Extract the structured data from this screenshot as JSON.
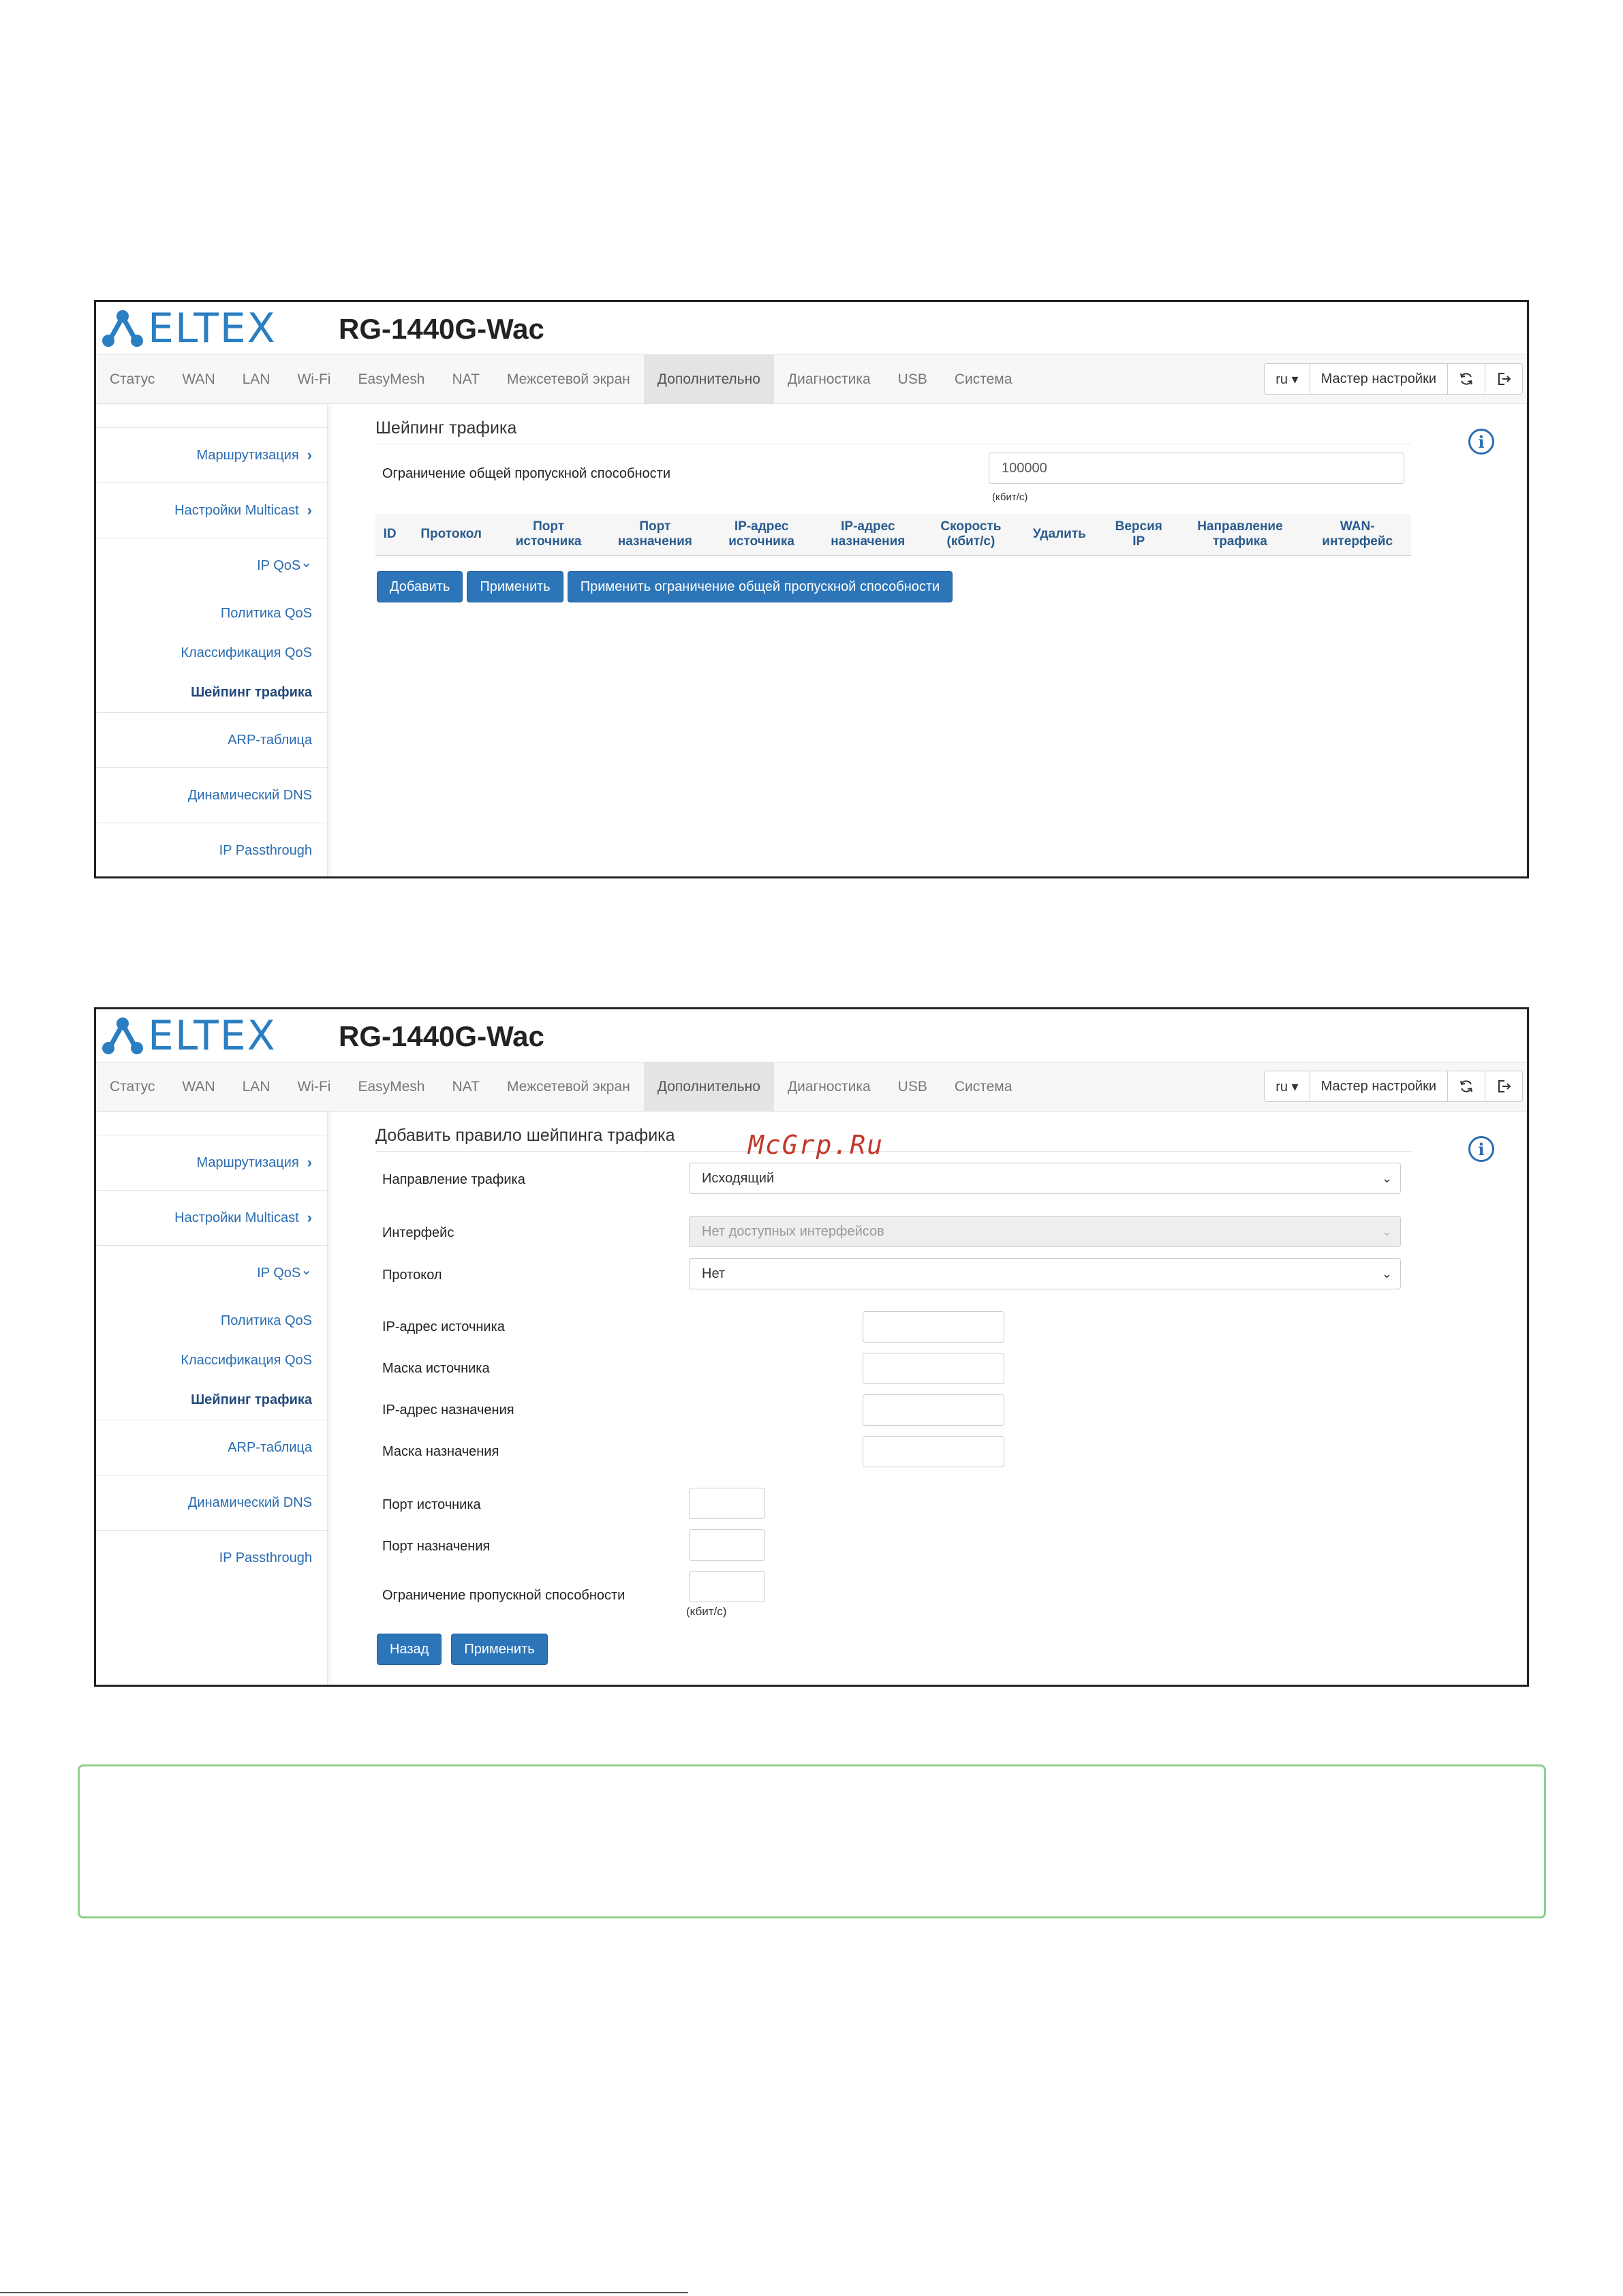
{
  "brand": {
    "logo_text": "ELTEX",
    "model": "RG-1440G-Wac",
    "brand_color": "#2a7ec2"
  },
  "nav": {
    "tabs": [
      "Статус",
      "WAN",
      "LAN",
      "Wi-Fi",
      "EasyMesh",
      "NAT",
      "Межсетевой экран",
      "Дополнительно",
      "Диагностика",
      "USB",
      "Система"
    ],
    "active_tab": "Дополнительно",
    "lang": "ru ▾",
    "wizard": "Мастер настройки",
    "refresh_icon": "refresh-icon",
    "logout_icon": "logout-icon"
  },
  "sidebar": {
    "routing": "Маршрутизация",
    "multicast": "Настройки Multicast",
    "ipqos": "IP QoS",
    "qos_policy": "Политика QoS",
    "qos_class": "Классификация QoS",
    "shaping": "Шейпинг трафика",
    "arp": "ARP-таблица",
    "ddns": "Динамический DNS",
    "passthrough": "IP Passthrough",
    "chevron_right": "›",
    "chevron_down": "⌄"
  },
  "screen1": {
    "title": "Шейпинг трафика",
    "bandwidth_label": "Ограничение общей пропускной способности",
    "bandwidth_value": "100000",
    "bandwidth_unit": "(кбит/с)",
    "columns": [
      "ID",
      "Протокол",
      "Порт\nисточника",
      "Порт\nназначения",
      "IP-адрес\nисточника",
      "IP-адрес\nназначения",
      "Скорость\n(кбит/с)",
      "Удалить",
      "Версия\nIP",
      "Направление\nтрафика",
      "WAN-\nинтерфейс"
    ],
    "buttons": {
      "add": "Добавить",
      "apply": "Применить",
      "apply_limit": "Применить ограничение общей пропускной способности"
    }
  },
  "screen2": {
    "title": "Добавить правило шейпинга трафика",
    "direction_label": "Направление трафика",
    "direction_value": "Исходящий",
    "interface_label": "Интерфейс",
    "interface_value": "Нет доступных интерфейсов",
    "protocol_label": "Протокол",
    "protocol_value": "Нет",
    "src_ip_label": "IP-адрес источника",
    "src_mask_label": "Маска источника",
    "dst_ip_label": "IP-адрес назначения",
    "dst_mask_label": "Маска назначения",
    "src_port_label": "Порт источника",
    "dst_port_label": "Порт назначения",
    "limit_label": "Ограничение пропускной способности",
    "limit_unit": "(кбит/с)",
    "buttons": {
      "back": "Назад",
      "apply": "Применить"
    }
  },
  "watermark": "McGrp.Ru"
}
